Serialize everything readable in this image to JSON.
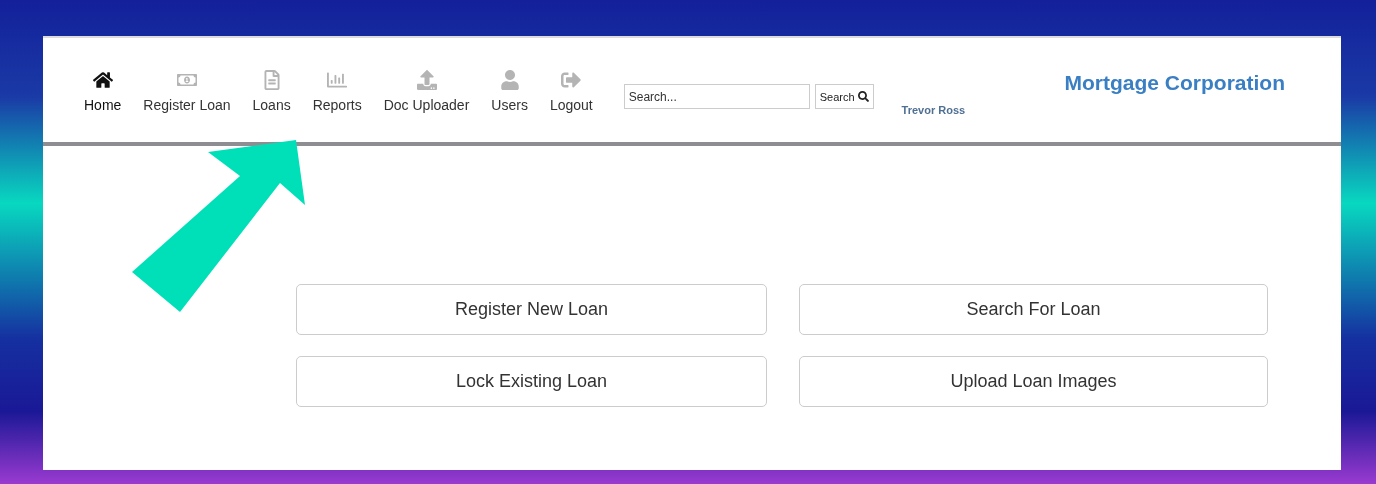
{
  "nav": [
    {
      "kind": "home",
      "label": "Home",
      "selected": true
    },
    {
      "kind": "money",
      "label": "Register Loan",
      "selected": false
    },
    {
      "kind": "file",
      "label": "Loans",
      "selected": false
    },
    {
      "kind": "chart",
      "label": "Reports",
      "selected": false
    },
    {
      "kind": "upload",
      "label": "Doc Uploader",
      "selected": false
    },
    {
      "kind": "user",
      "label": "Users",
      "selected": false
    },
    {
      "kind": "logout",
      "label": "Logout",
      "selected": false
    }
  ],
  "search": {
    "placeholder": "Search...",
    "button": "Search"
  },
  "user": "Trevor Ross",
  "brand": "Mortgage Corporation",
  "actions": [
    "Register New Loan",
    "Search For Loan",
    "Lock Existing Loan",
    "Upload Loan Images"
  ]
}
